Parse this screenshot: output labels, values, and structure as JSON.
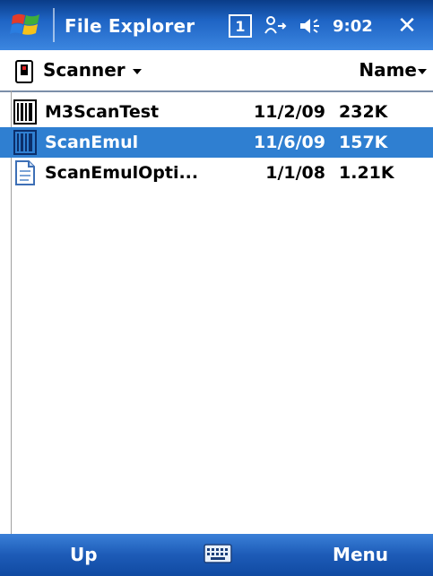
{
  "titlebar": {
    "title": "File Explorer",
    "status_badge": "1",
    "time": "9:02",
    "close_glyph": "✕"
  },
  "folderbar": {
    "folder": "Scanner",
    "sort": "Name"
  },
  "files": [
    {
      "name": "M3ScanTest",
      "date": "11/2/09",
      "size": "232K",
      "icon": "barcode-icon",
      "selected": false
    },
    {
      "name": "ScanEmul",
      "date": "11/6/09",
      "size": "157K",
      "icon": "barcode-icon",
      "selected": true
    },
    {
      "name": "ScanEmulOpti...",
      "date": "1/1/08",
      "size": "1.21K",
      "icon": "document-icon",
      "selected": false
    }
  ],
  "softkeys": {
    "left": "Up",
    "right": "Menu"
  },
  "colors": {
    "titlebar": "#1e64c4",
    "selection": "#2f7fd1",
    "softkey_bar": "#1d5bb7"
  }
}
